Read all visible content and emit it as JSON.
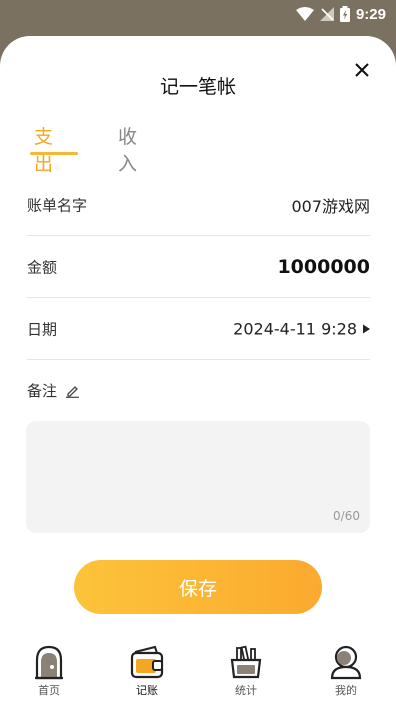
{
  "status_bar": {
    "time": "9:29"
  },
  "sheet": {
    "title": "记一笔帐",
    "tabs": [
      {
        "label": "支出",
        "active": true
      },
      {
        "label": "收入",
        "active": false
      }
    ],
    "fields": {
      "bill_name": {
        "label": "账单名字",
        "value": "007游戏网"
      },
      "amount": {
        "label": "金额",
        "value": "1000000"
      },
      "date": {
        "label": "日期",
        "value": "2024-4-11 9:28"
      },
      "remark": {
        "label": "备注",
        "value": "",
        "counter": "0/60"
      }
    },
    "save_label": "保存"
  },
  "tabbar": {
    "items": [
      {
        "label": "首页",
        "icon": "home-icon",
        "active": false
      },
      {
        "label": "记账",
        "icon": "wallet-icon",
        "active": true
      },
      {
        "label": "统计",
        "icon": "stats-icon",
        "active": false
      },
      {
        "label": "我的",
        "icon": "profile-icon",
        "active": false
      }
    ]
  },
  "colors": {
    "accent": "#f5a623",
    "button_start": "#fcc33a",
    "button_end": "#fbaa2f",
    "dim_background": "#7a7160"
  }
}
